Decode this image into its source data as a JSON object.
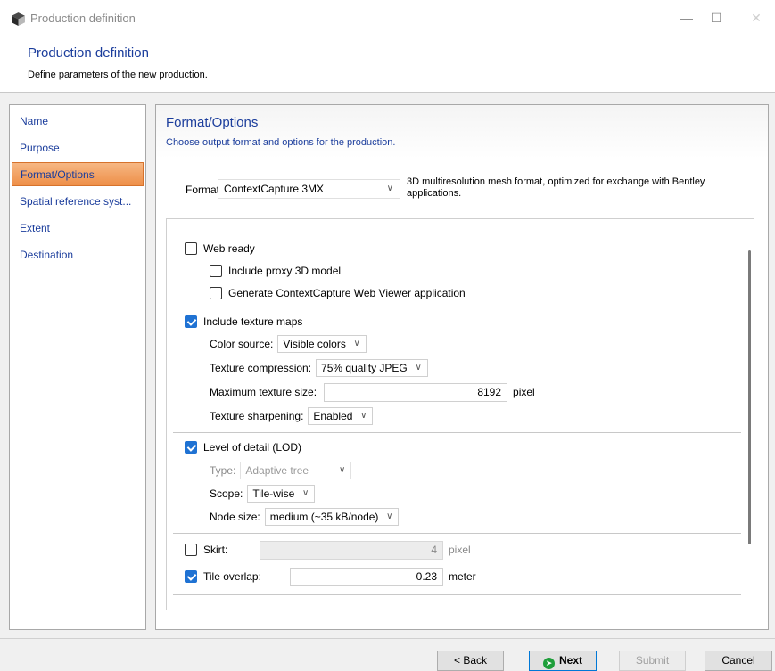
{
  "window": {
    "title": "Production definition",
    "minimize_glyph": "—",
    "maximize_glyph": "☐",
    "close_glyph": "✕"
  },
  "header": {
    "title": "Production definition",
    "subtitle": "Define parameters of the new production."
  },
  "nav": {
    "items": [
      {
        "label": "Name"
      },
      {
        "label": "Purpose"
      },
      {
        "label": "Format/Options",
        "active": true
      },
      {
        "label": "Spatial reference syst..."
      },
      {
        "label": "Extent"
      },
      {
        "label": "Destination"
      }
    ]
  },
  "panel": {
    "title": "Format/Options",
    "subtitle": "Choose output format and options for the production."
  },
  "format": {
    "label": "Format:",
    "value": "ContextCapture 3MX",
    "description": "3D multiresolution mesh format, optimized for exchange with Bentley applications."
  },
  "options": {
    "web_ready": {
      "label": "Web ready",
      "checked": false
    },
    "include_proxy": {
      "label": "Include proxy 3D model",
      "checked": false
    },
    "generate_viewer": {
      "label": "Generate ContextCapture Web Viewer application",
      "checked": false
    },
    "texture_maps": {
      "label": "Include texture maps",
      "checked": true
    },
    "color_source": {
      "label": "Color source:",
      "value": "Visible colors"
    },
    "texture_compression": {
      "label": "Texture compression:",
      "value": "75% quality JPEG"
    },
    "max_texture_size": {
      "label": "Maximum texture size:",
      "value": "8192",
      "unit": "pixel"
    },
    "texture_sharpening": {
      "label": "Texture sharpening:",
      "value": "Enabled"
    },
    "lod": {
      "label": "Level of detail (LOD)",
      "checked": true
    },
    "lod_type": {
      "label": "Type:",
      "value": "Adaptive tree"
    },
    "lod_scope": {
      "label": "Scope:",
      "value": "Tile-wise"
    },
    "node_size": {
      "label": "Node size:",
      "value": "medium (~35 kB/node)"
    },
    "skirt": {
      "label": "Skirt:",
      "checked": false,
      "value": "4",
      "unit": "pixel"
    },
    "tile_overlap": {
      "label": "Tile overlap:",
      "checked": true,
      "value": "0.23",
      "unit": "meter"
    }
  },
  "buttons": {
    "back": "< Back",
    "next": "Next",
    "submit": "Submit",
    "cancel": "Cancel"
  },
  "colors": {
    "accent_blue": "#1b3d9c",
    "active_nav": "#ee8f48",
    "checkbox_checked": "#1f72d3",
    "next_icon": "#1e9e3a"
  },
  "icons": {
    "app": "app-cube-icon",
    "next": "arrow-right-circle-icon",
    "dropdown": "chevron-down-icon"
  }
}
